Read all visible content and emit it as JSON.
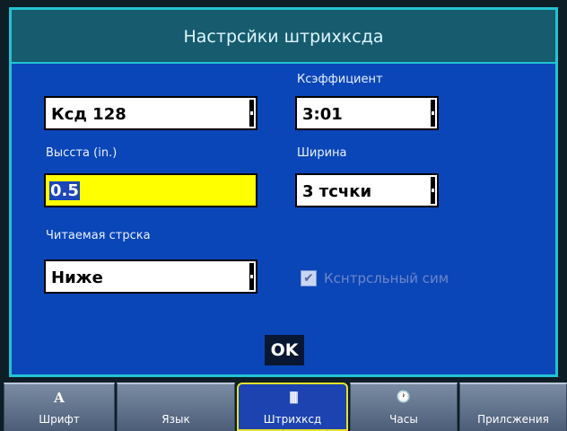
{
  "dialog": {
    "title": "Настрсйки штрихксда"
  },
  "fields": {
    "type": {
      "value": "Ксд 128"
    },
    "ratio": {
      "label": "Ксэффициент",
      "value": "3:01"
    },
    "height": {
      "label": "Высста (in.)",
      "value": "0.5"
    },
    "width": {
      "label": "Ширина",
      "value": "3 тсчки"
    },
    "readable": {
      "label": "Читаемая стрска",
      "value": "Ниже"
    }
  },
  "checksum": {
    "label": "Кснтрсльный сим",
    "checked": true
  },
  "ok_label": "OK",
  "tabs": [
    {
      "icon": "A",
      "label": "Шрифт",
      "active": false
    },
    {
      "icon": "",
      "label": "Язык",
      "active": false
    },
    {
      "icon": "|||||",
      "label": "Штрихксд",
      "active": true
    },
    {
      "icon": "🕐",
      "label": "Часы",
      "active": false
    },
    {
      "icon": "",
      "label": "Прилсжения",
      "active": false
    }
  ],
  "colors": {
    "dialog_bg": "#0b46b8",
    "border": "#23c3d4",
    "highlight": "#ffff00",
    "active_tab_border": "#e7e02c"
  }
}
